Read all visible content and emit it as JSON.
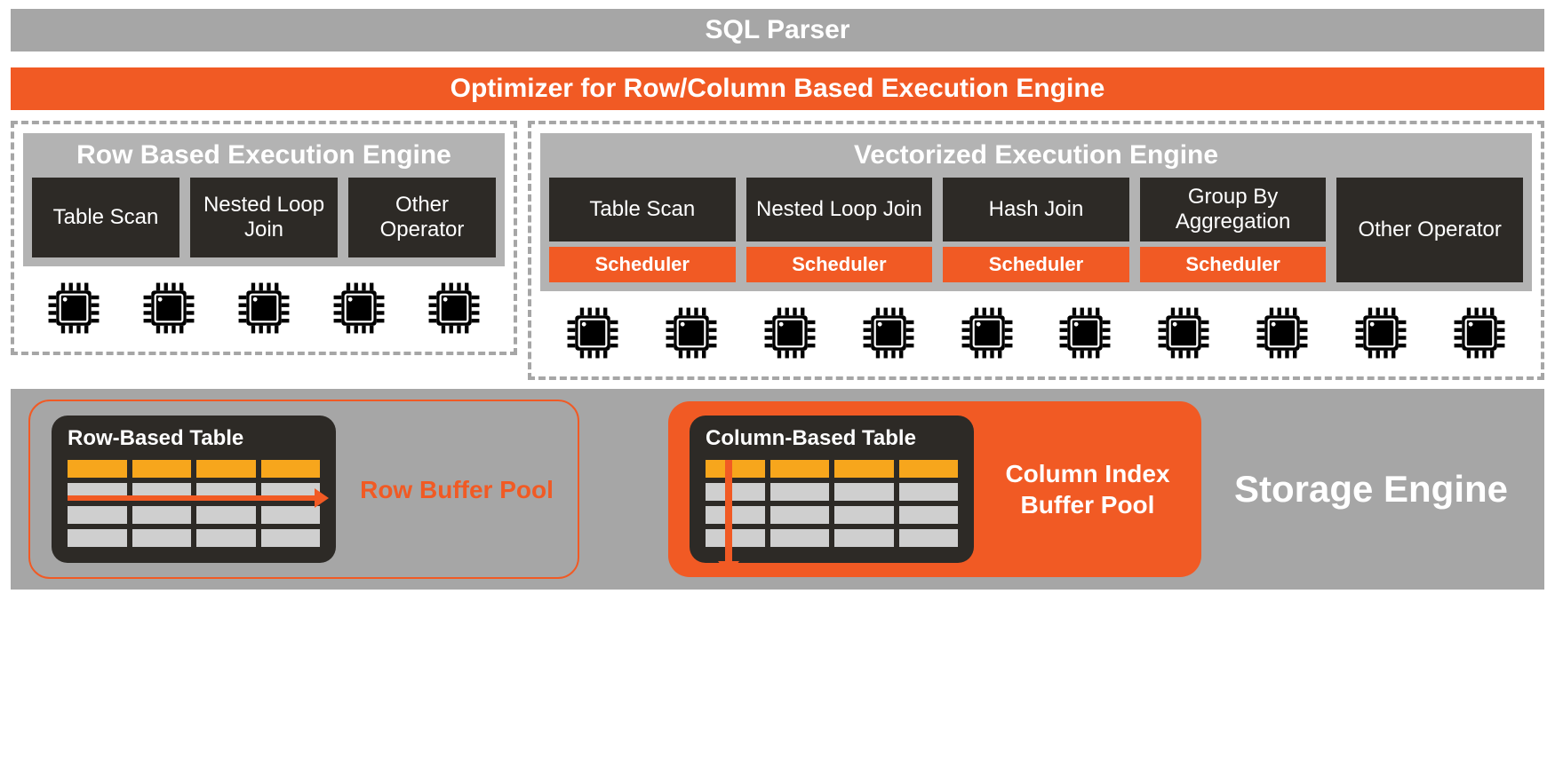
{
  "sql_parser": "SQL Parser",
  "optimizer": "Optimizer for Row/Column Based Execution Engine",
  "row_engine": {
    "title": "Row Based Execution Engine",
    "ops": [
      "Table Scan",
      "Nested Loop Join",
      "Other Operator"
    ],
    "chip_count": 5
  },
  "vec_engine": {
    "title": "Vectorized Execution Engine",
    "ops": [
      {
        "label": "Table Scan",
        "scheduler": "Scheduler"
      },
      {
        "label": "Nested Loop Join",
        "scheduler": "Scheduler"
      },
      {
        "label": "Hash Join",
        "scheduler": "Scheduler"
      },
      {
        "label": "Group By Aggregation",
        "scheduler": "Scheduler"
      },
      {
        "label": "Other Operator",
        "scheduler": null
      }
    ],
    "chip_count": 10
  },
  "storage": {
    "row_table_title": "Row-Based Table",
    "row_pool_label": "Row Buffer Pool",
    "col_table_title": "Column-Based Table",
    "col_pool_label": "Column  Index Buffer Pool",
    "storage_title": "Storage Engine"
  }
}
